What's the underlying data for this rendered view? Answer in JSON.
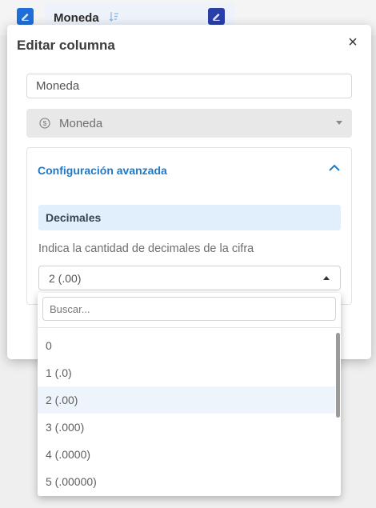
{
  "background": {
    "column_title": "Moneda"
  },
  "modal": {
    "title": "Editar columna",
    "close_label": "×",
    "name_field": {
      "value": "Moneda",
      "placeholder": ""
    },
    "type_select": {
      "value": "Moneda",
      "icon": "dollar-circle-icon",
      "disabled": true
    },
    "advanced": {
      "title": "Configuración avanzada",
      "expanded": true,
      "decimals": {
        "header": "Decimales",
        "help": "Indica la cantidad de decimales de la cifra",
        "selected": "2 (.00)"
      }
    }
  },
  "dropdown": {
    "search_placeholder": "Buscar...",
    "options": [
      {
        "label": "0"
      },
      {
        "label": "1 (.0)"
      },
      {
        "label": "2 (.00)",
        "selected": true
      },
      {
        "label": "3 (.000)"
      },
      {
        "label": "4 (.0000)"
      },
      {
        "label": "5 (.00000)"
      }
    ]
  },
  "colors": {
    "accent_blue": "#1e78c8",
    "edit_button_blue": "#1e6fd9",
    "edit_button_dark": "#2a3fa8",
    "decimals_header_bg": "#e1eefb",
    "selected_option_bg": "#eef4fb"
  }
}
